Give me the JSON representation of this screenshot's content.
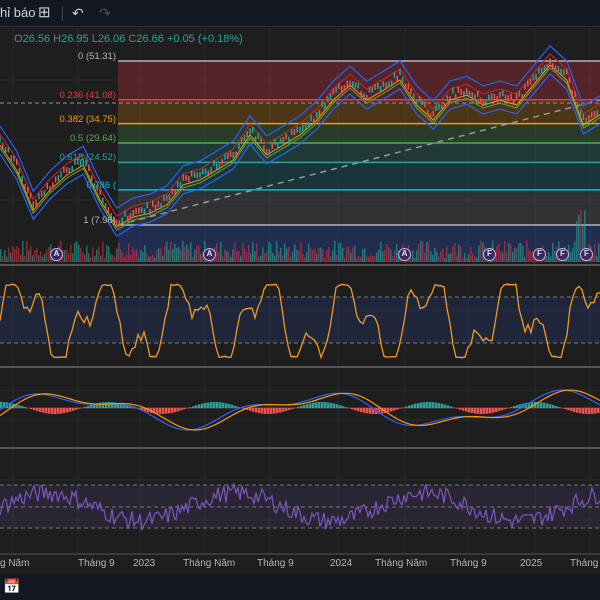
{
  "toolbar": {
    "indicators_label": "hỉ báo",
    "layout_icon": "layout-grid-icon",
    "undo_icon": "undo-icon",
    "redo_icon": "redo-icon"
  },
  "ohlc": {
    "o_label": "O",
    "o": "26.56",
    "h_label": "H",
    "h": "26.95",
    "l_label": "L",
    "l": "26.06",
    "c_label": "C",
    "c": "26.66",
    "change": "+0.05 (+0.18%)"
  },
  "fib": {
    "levels": [
      {
        "label": "0 (51.31)",
        "price": 51.31,
        "color": "#b2b5be"
      },
      {
        "label": "0.236 (41.08)",
        "price": 41.08,
        "color": "#f23645"
      },
      {
        "label": "0.382 (34.75)",
        "price": 34.75,
        "color": "#ff9800"
      },
      {
        "label": "0.5 (29.64)",
        "price": 29.64,
        "color": "#4caf50"
      },
      {
        "label": "0.618 (24.52)",
        "price": 24.52,
        "color": "#26a69a"
      },
      {
        "label": "0.786 (",
        "price": 17.24,
        "color": "#00bcd4"
      },
      {
        "label": "1 (7.96)",
        "price": 7.96,
        "color": "#b2b5be"
      }
    ]
  },
  "price_series": [
    30.4,
    23.8,
    13.2,
    18.5,
    22.5,
    25.1,
    15.9,
    8.7,
    11.4,
    12.4,
    14.6,
    19.9,
    21.2,
    23.8,
    26.5,
    33.1,
    27.8,
    30.4,
    33.1,
    37.0,
    42.3,
    46.3,
    42.3,
    44.9,
    47.6,
    41.0,
    37.0,
    42.3,
    43.6,
    41.0,
    42.3,
    41.0,
    46.3,
    51.6,
    47.6,
    35.7,
    38.4
  ],
  "events": [
    "A",
    "A",
    "A",
    "F",
    "F",
    "F",
    "F"
  ],
  "time_axis": [
    "g Năm",
    "Tháng 9",
    "2023",
    "Tháng Năm",
    "Tháng 9",
    "2024",
    "Tháng Năm",
    "Tháng 9",
    "2025",
    "Tháng N"
  ],
  "bottom": {
    "goto_date_icon": "calendar-goto-icon"
  }
}
